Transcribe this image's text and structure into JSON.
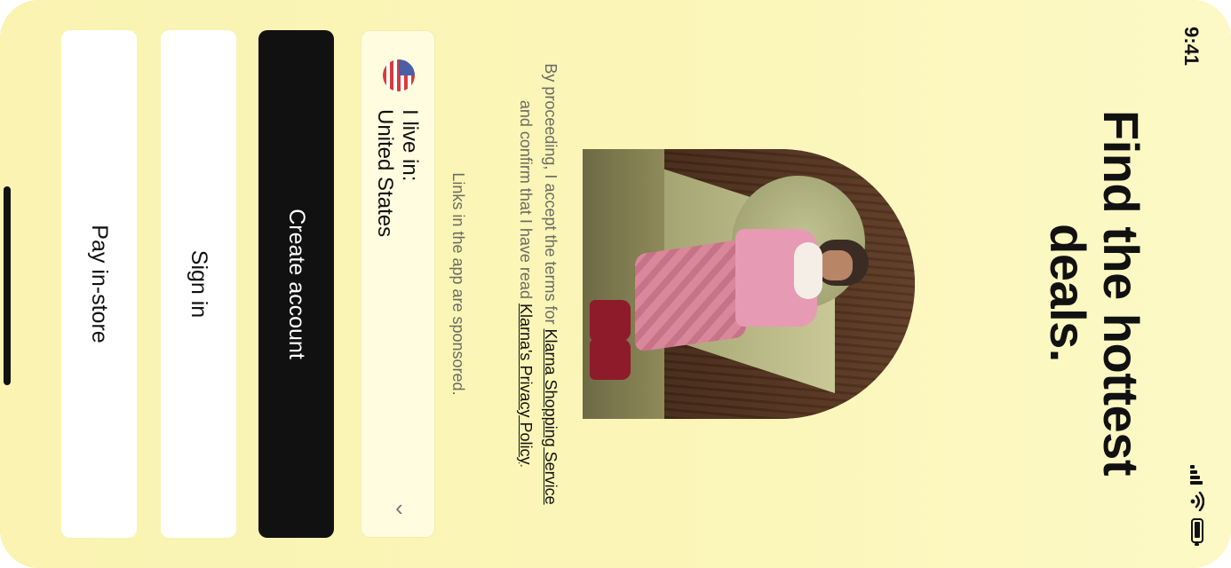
{
  "status_bar": {
    "time": "9:41"
  },
  "headline": "Find the hottest deals.",
  "legal": {
    "prefix": "By proceeding, I accept the terms for ",
    "link1": "Klarna Shopping Service",
    "middle": " and confirm that I have read ",
    "link2": "Klarna's Privacy Policy",
    "suffix": "."
  },
  "sponsored": "Links in the app are sponsored.",
  "country": {
    "label": "I live in:",
    "value": "United States"
  },
  "buttons": {
    "create": "Create account",
    "signin": "Sign in",
    "pay": "Pay in-store"
  },
  "icons": [
    "signal-icon",
    "wifi-icon",
    "battery-icon",
    "us-flag-icon",
    "chevron-down-icon"
  ],
  "colors": {
    "background": "#fbf6b6",
    "primary_button": "#111111",
    "secondary_button": "#ffffff"
  }
}
